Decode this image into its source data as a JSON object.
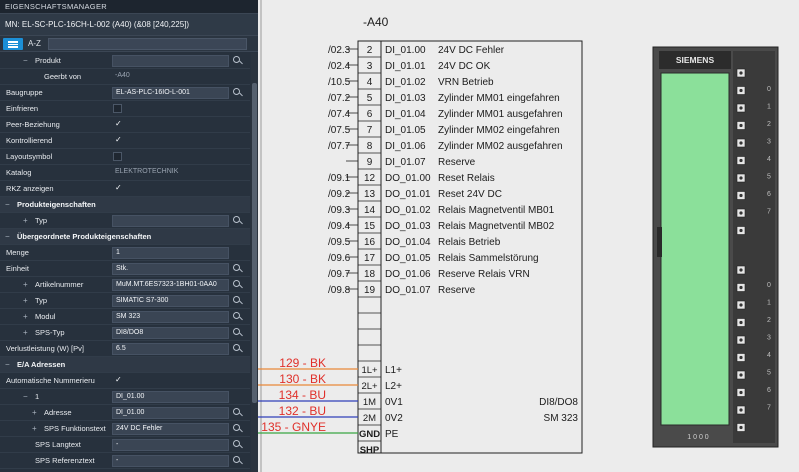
{
  "panel": {
    "title": "EIGENSCHAFTSMANAGER",
    "mn": "MN: EL-SC-PLC-16CH-L-002 (A40) (&08 [240,225])",
    "sort_label": "A-Z",
    "filter_value": "",
    "rows": [
      {
        "label": "Produkt",
        "indent": 2,
        "toggle": "−",
        "value": "",
        "style": "field",
        "search": true
      },
      {
        "label": "Geerbt von",
        "indent": 3,
        "value": "-A40",
        "style": "grey"
      },
      {
        "label": "Baugruppe",
        "indent": 0,
        "value": "EL-AS-PLC-16IO-L-001",
        "style": "field",
        "search": true
      },
      {
        "label": "Einfrieren",
        "indent": 0,
        "value": "",
        "style": "box"
      },
      {
        "label": "Peer-Beziehung",
        "indent": 0,
        "value": "✓",
        "style": "check"
      },
      {
        "label": "Kontrollierend",
        "indent": 0,
        "value": "✓",
        "style": "check"
      },
      {
        "label": "Layoutsymbol",
        "indent": 0,
        "value": "",
        "style": "box"
      },
      {
        "label": "Katalog",
        "indent": 0,
        "value": "ELEKTROTECHNIK",
        "style": "grey"
      },
      {
        "label": "RKZ anzeigen",
        "indent": 0,
        "value": "✓",
        "style": "check"
      },
      {
        "label": "Produkteigenschaften",
        "indent": 0,
        "toggle": "−",
        "section": true
      },
      {
        "label": "Typ",
        "indent": 2,
        "toggle": "+",
        "value": "",
        "style": "field",
        "search": true
      },
      {
        "label": "Übergeordnete Produkteigenschaften",
        "indent": 0,
        "toggle": "−",
        "section": true
      },
      {
        "label": "Menge",
        "indent": 0,
        "value": "1",
        "style": "field"
      },
      {
        "label": "Einheit",
        "indent": 0,
        "value": "Stk.",
        "style": "field",
        "search": true
      },
      {
        "label": "Artikelnummer",
        "indent": 2,
        "toggle": "+",
        "value": "MuM.MT.6ES7323-1BH01-0AA0",
        "style": "field",
        "search": true
      },
      {
        "label": "Typ",
        "indent": 2,
        "toggle": "+",
        "value": "SIMATIC S7-300",
        "style": "field",
        "search": true
      },
      {
        "label": "Modul",
        "indent": 2,
        "toggle": "+",
        "value": "SM 323",
        "style": "field",
        "search": true
      },
      {
        "label": "SPS-Typ",
        "indent": 2,
        "toggle": "+",
        "value": "DI8/DO8",
        "style": "field",
        "search": true
      },
      {
        "label": "Verlustleistung (W) [Pv]",
        "indent": 0,
        "value": "6.5",
        "style": "field",
        "search": true
      },
      {
        "label": "E/A Adressen",
        "indent": 0,
        "toggle": "−",
        "section": true
      },
      {
        "label": "Automatische Nummerieru",
        "indent": 0,
        "value": "✓",
        "style": "check"
      },
      {
        "label": "1",
        "indent": 2,
        "toggle": "−",
        "value": "DI_01.00",
        "style": "field"
      },
      {
        "label": "Adresse",
        "indent": 3,
        "toggle": "+",
        "value": "DI_01.00",
        "style": "field",
        "search": true
      },
      {
        "label": "SPS Funktionstext",
        "indent": 3,
        "toggle": "+",
        "value": "24V DC Fehler",
        "style": "field",
        "search": true
      },
      {
        "label": "SPS Langtext",
        "indent": 2,
        "value": "-",
        "style": "field",
        "search": true
      },
      {
        "label": "SPS Referenztext",
        "indent": 2,
        "value": "-",
        "style": "field",
        "search": true
      }
    ]
  },
  "schematic": {
    "device_tag": "-A40",
    "module_type": "DI8/DO8",
    "module_name": "SM 323",
    "plc_brand": "SIEMENS",
    "io_rows": [
      {
        "ref": "/02.3",
        "pin": "2",
        "addr": "DI_01.00",
        "text": "24V DC Fehler"
      },
      {
        "ref": "/02.4",
        "pin": "3",
        "addr": "DI_01.01",
        "text": "24V DC  OK"
      },
      {
        "ref": "/10.5",
        "pin": "4",
        "addr": "DI_01.02",
        "text": "VRN Betrieb"
      },
      {
        "ref": "/07.2",
        "pin": "5",
        "addr": "DI_01.03",
        "text": "Zylinder MM01 eingefahren"
      },
      {
        "ref": "/07.4",
        "pin": "6",
        "addr": "DI_01.04",
        "text": "Zylinder MM01 ausgefahren"
      },
      {
        "ref": "/07.5",
        "pin": "7",
        "addr": "DI_01.05",
        "text": "Zylinder MM02 eingefahren"
      },
      {
        "ref": "/07.7",
        "pin": "8",
        "addr": "DI_01.06",
        "text": "Zylinder MM02 ausgefahren"
      },
      {
        "ref": "",
        "pin": "9",
        "addr": "DI_01.07",
        "text": "Reserve"
      },
      {
        "ref": "/09.1",
        "pin": "12",
        "addr": "DO_01.00",
        "text": "Reset Relais"
      },
      {
        "ref": "/09.2",
        "pin": "13",
        "addr": "DO_01.01",
        "text": "Reset 24V DC"
      },
      {
        "ref": "/09.3",
        "pin": "14",
        "addr": "DO_01.02",
        "text": "Relais Magnetventil MB01"
      },
      {
        "ref": "/09.4",
        "pin": "15",
        "addr": "DO_01.03",
        "text": "Relais Magnetventil MB02"
      },
      {
        "ref": "/09.5",
        "pin": "16",
        "addr": "DO_01.04",
        "text": "Relais Betrieb"
      },
      {
        "ref": "/09.6",
        "pin": "17",
        "addr": "DO_01.05",
        "text": "Relais Sammelstörung"
      },
      {
        "ref": "/09.7",
        "pin": "18",
        "addr": "DO_01.06",
        "text": "Reserve Relais VRN"
      },
      {
        "ref": "/09.8",
        "pin": "19",
        "addr": "DO_01.07",
        "text": "Reserve"
      }
    ],
    "power_rows": [
      {
        "wire": "129 - BK",
        "pin": "1L+",
        "label": "L1+",
        "color": "#e0302a",
        "wire_color": "#e8883a"
      },
      {
        "wire": "130 - BK",
        "pin": "2L+",
        "label": "L2+",
        "color": "#e0302a",
        "wire_color": "#e8883a"
      },
      {
        "wire": "134 - BU",
        "pin": "1M",
        "label": "0V1",
        "color": "#e0302a",
        "wire_color": "#2f3fb8"
      },
      {
        "wire": "132 - BU",
        "pin": "2M",
        "label": "0V2",
        "color": "#e0302a",
        "wire_color": "#2f3fb8"
      },
      {
        "wire": "135 - GNYE",
        "pin": "GND",
        "label": "PE",
        "color": "#e0302a",
        "wire_color": "#3aa642"
      },
      {
        "wire": "",
        "pin": "SHP",
        "label": "",
        "color": "#e0302a",
        "wire_color": ""
      }
    ],
    "plc_left_marks": [
      "0",
      "1",
      "2",
      "3",
      "4",
      "5",
      "6",
      "7"
    ],
    "plc_right_marks": [
      "0",
      "1",
      "2",
      "3",
      "4",
      "5",
      "6",
      "7"
    ],
    "plc_bottom_marks": "1  0  0  0",
    "colors": {
      "plc_screen": "#8be09a",
      "plc_body": "#3c3c3c"
    }
  }
}
